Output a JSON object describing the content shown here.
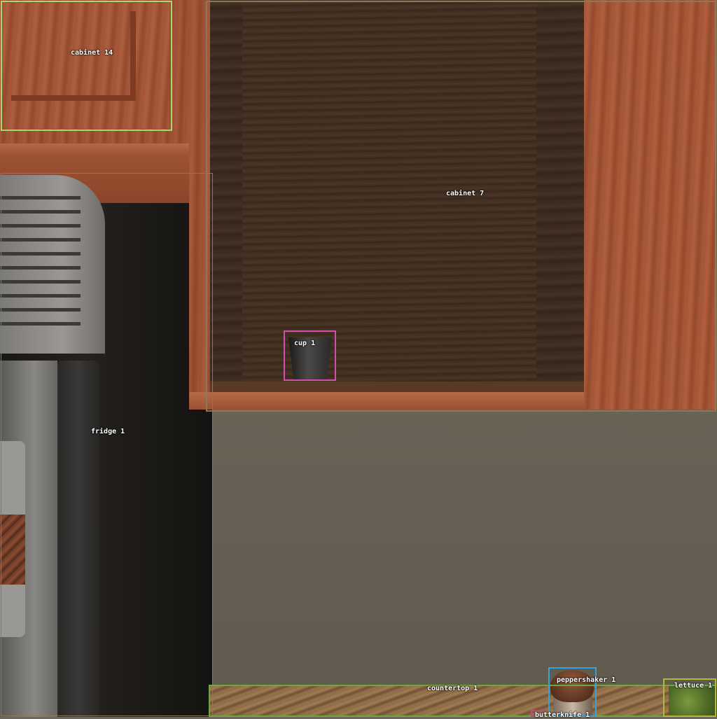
{
  "detections": [
    {
      "label": "cabinet 14",
      "color": "#a6d86a"
    },
    {
      "label": "cabinet 7",
      "color": "#8a7a5c"
    },
    {
      "label": "fridge 1",
      "color": "#8a7a5c"
    },
    {
      "label": "cup 1",
      "color": "#d04fb0"
    },
    {
      "label": "countertop 1",
      "color": "#6aaa3a"
    },
    {
      "label": "peppershaker 1",
      "color": "#3aa0d8"
    },
    {
      "label": "lettuce 1",
      "color": "#b4b838"
    },
    {
      "label": "butterknife 1",
      "color": "#c04a7a"
    }
  ]
}
